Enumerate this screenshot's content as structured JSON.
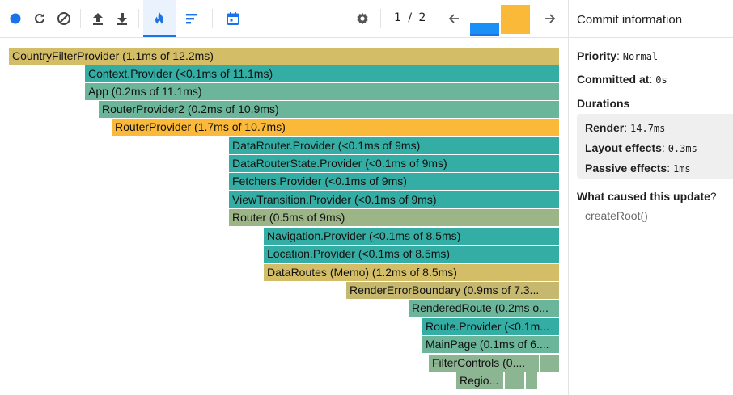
{
  "toolbar": {
    "icons": [
      "record-icon",
      "reload-icon",
      "clear-icon",
      "upload-icon",
      "download-icon",
      "flame-chart-icon",
      "ranked-chart-icon",
      "timeline-icon",
      "gear-icon",
      "prev-commit-icon",
      "next-commit-icon"
    ],
    "commit_current": "1",
    "commit_sep": "/",
    "commit_total": "2",
    "commits": [
      {
        "level": 0.4,
        "color": "#1a8ff5",
        "selected": true
      },
      {
        "level": 1.0,
        "color": "#fbb93a",
        "selected": false
      }
    ],
    "accent": "#1a73e8"
  },
  "flamegraph": {
    "bars": [
      {
        "label": "CountryFilterProvider (1.1ms of 12.2ms)",
        "color": "#d3bd67"
      },
      {
        "label": "Context.Provider (<0.1ms of 11.1ms)",
        "color": "#34aea4"
      },
      {
        "label": "App (0.2ms of 11.1ms)",
        "color": "#6bb59b"
      },
      {
        "label": "RouterProvider2 (0.2ms of 10.9ms)",
        "color": "#6bb59b"
      },
      {
        "label": "RouterProvider (1.7ms of 10.7ms)",
        "color": "#fbb93a"
      },
      {
        "label": "DataRouter.Provider (<0.1ms of 9ms)",
        "color": "#34aea4"
      },
      {
        "label": "DataRouterState.Provider (<0.1ms of 9ms)",
        "color": "#34aea4"
      },
      {
        "label": "Fetchers.Provider (<0.1ms of 9ms)",
        "color": "#34aea4"
      },
      {
        "label": "ViewTransition.Provider (<0.1ms of 9ms)",
        "color": "#34aea4"
      },
      {
        "label": "Router (0.5ms of 9ms)",
        "color": "#9bb586"
      },
      {
        "label": "Navigation.Provider (<0.1ms of 8.5ms)",
        "color": "#34aea4"
      },
      {
        "label": "Location.Provider (<0.1ms of 8.5ms)",
        "color": "#34aea4"
      },
      {
        "label": "DataRoutes (Memo) (1.2ms of 8.5ms)",
        "color": "#d3bd67"
      },
      {
        "label": "RenderErrorBoundary (0.9ms of 7.3...",
        "color": "#c6b86f"
      },
      {
        "label": "RenderedRoute (0.2ms o...",
        "color": "#6bb59b"
      },
      {
        "label": "Route.Provider (<0.1m...",
        "color": "#34aea4"
      },
      {
        "label": "MainPage (0.1ms of 6....",
        "color": "#6bb59b"
      },
      {
        "label": "FilterControls (0....",
        "color": "#8cb592"
      },
      {
        "label": "",
        "color": "#8cb592"
      },
      {
        "label": "Regio...",
        "color": "#8cb592"
      },
      {
        "label": "",
        "color": "#8cb592"
      },
      {
        "label": "",
        "color": "#8cb592"
      }
    ]
  },
  "commit_info": {
    "title": "Commit information",
    "priority_label": "Priority",
    "priority_value": "Normal",
    "committed_label": "Committed at",
    "committed_value": "0s",
    "durations_label": "Durations",
    "render_label": "Render",
    "render_value": "14.7ms",
    "layout_label": "Layout effects",
    "layout_value": "0.3ms",
    "passive_label": "Passive effects",
    "passive_value": "1ms",
    "cause_label": "What caused this update",
    "cause_q": "?",
    "cause_value": "createRoot()"
  }
}
